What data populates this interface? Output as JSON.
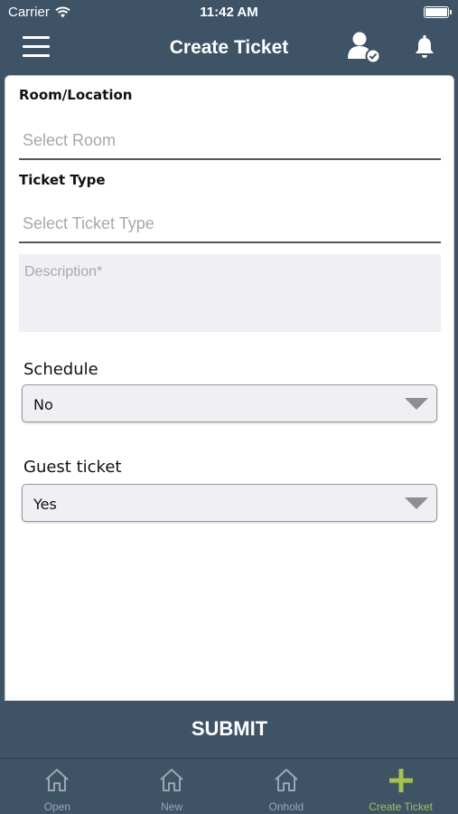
{
  "status_bar": {
    "carrier": "Carrier",
    "time": "11:42 AM"
  },
  "navbar": {
    "title": "Create Ticket",
    "icons": [
      "menu-icon",
      "user-check-icon",
      "bell-icon"
    ]
  },
  "form": {
    "room_label": "Room/Location",
    "room_placeholder": "Select Room",
    "ticket_type_label": "Ticket Type",
    "ticket_type_placeholder": "Select Ticket Type",
    "description_placeholder": "Description*",
    "schedule_label": "Schedule",
    "schedule_value": "No",
    "guest_label": "Guest ticket",
    "guest_value": "Yes",
    "submit_label": "SUBMIT"
  },
  "tabs": [
    {
      "label": "Open",
      "icon": "home-icon",
      "active": false
    },
    {
      "label": "New",
      "icon": "home-icon",
      "active": false
    },
    {
      "label": "Onhold",
      "icon": "home-icon",
      "active": false
    },
    {
      "label": "Create Ticket",
      "icon": "plus-icon",
      "active": true
    }
  ],
  "colors": {
    "primary": "#3f5366",
    "active_tab": "#a6c247",
    "field_bg": "#efeff4",
    "placeholder": "#a8a8ad"
  }
}
